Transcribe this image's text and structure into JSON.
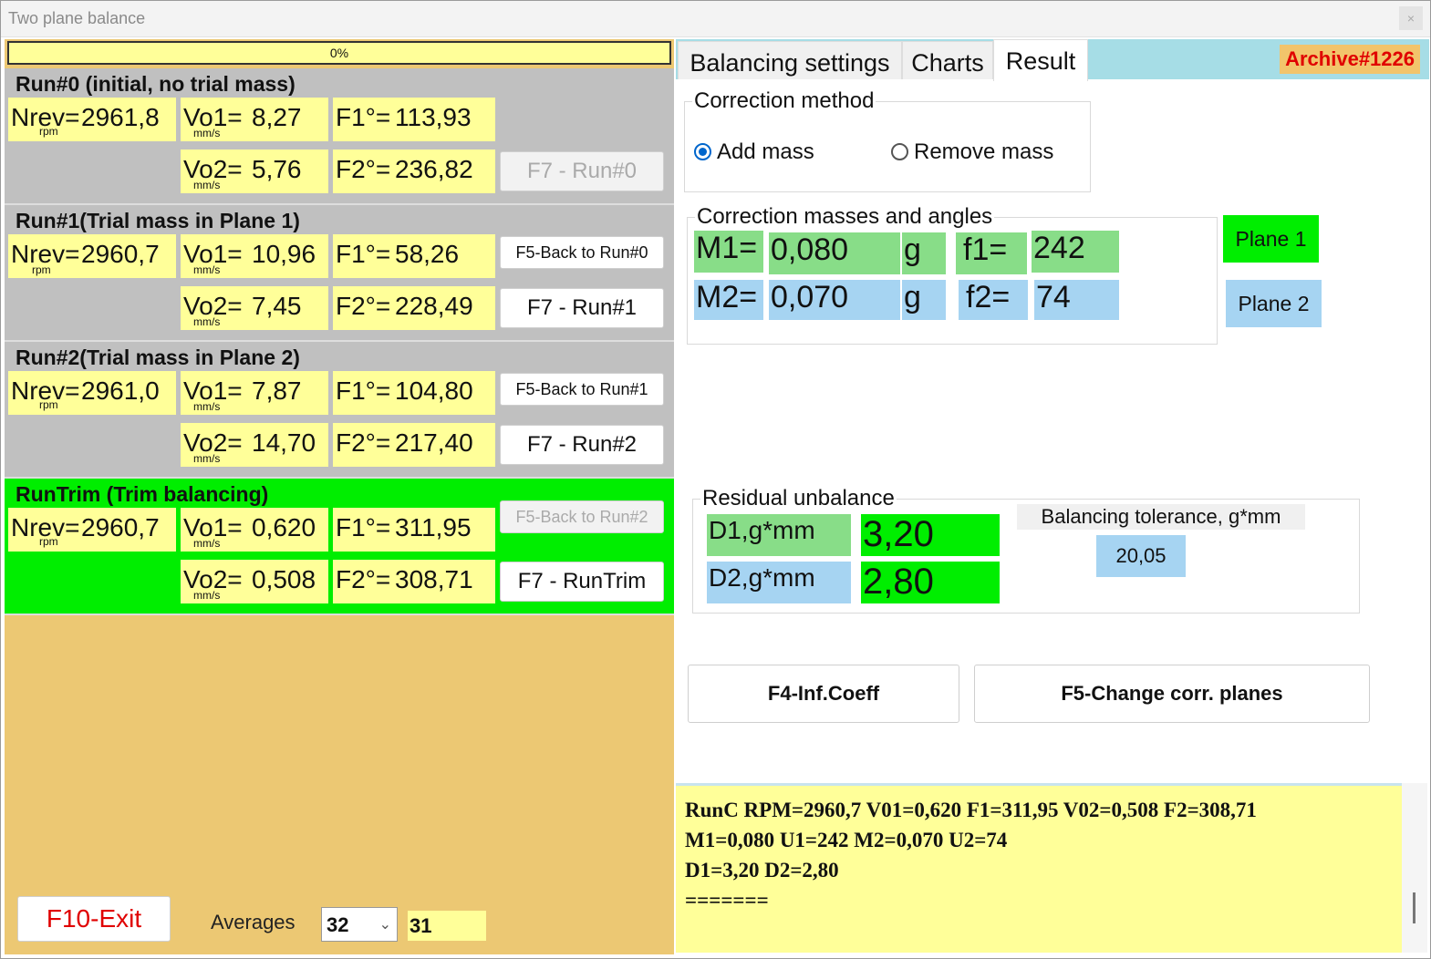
{
  "window": {
    "title": "Two plane balance",
    "close_label": "×"
  },
  "progress": {
    "text": "0%",
    "value": 0
  },
  "labels": {
    "nrev": "Nrev=",
    "rpm": "rpm",
    "vo1": "Vo1=",
    "vo2": "Vo2=",
    "mms": "mm/s",
    "f1": "F1°=",
    "f2": "F2°="
  },
  "runs": [
    {
      "title": "Run#0 (initial, no trial mass)",
      "nrev": "2961,8",
      "vo1": "8,27",
      "f1": "113,93",
      "vo2": "5,76",
      "f2": "236,82",
      "f7_label": "F7 - Run#0"
    },
    {
      "title": "Run#1(Trial mass in Plane 1)",
      "nrev": "2960,7",
      "vo1": "10,96",
      "f1": "58,26",
      "vo2": "7,45",
      "f2": "228,49",
      "f5_label": "F5-Back to Run#0",
      "f7_label": "F7 - Run#1"
    },
    {
      "title": "Run#2(Trial mass in Plane 2)",
      "nrev": "2961,0",
      "vo1": "7,87",
      "f1": "104,80",
      "vo2": "14,70",
      "f2": "217,40",
      "f5_label": "F5-Back to Run#1",
      "f7_label": "F7 - Run#2"
    },
    {
      "title": "RunTrim (Trim balancing)",
      "nrev": "2960,7",
      "vo1": "0,620",
      "f1": "311,95",
      "vo2": "0,508",
      "f2": "308,71",
      "f5_label": "F5-Back to Run#2",
      "f7_label": "F7 - RunTrim"
    }
  ],
  "footer": {
    "exit_label": "F10-Exit",
    "averages_label": "Averages",
    "averages_selected": "32",
    "averages_value": "31"
  },
  "tabs": [
    {
      "label": "Balancing settings"
    },
    {
      "label": "Charts"
    },
    {
      "label": "Result"
    }
  ],
  "archive": "Archive#1226",
  "correction_method": {
    "title": "Correction method",
    "options": [
      "Add mass",
      "Remove mass"
    ],
    "selected": "Add mass"
  },
  "correction_masses": {
    "title": "Correction masses and angles",
    "m1_label": "M1=",
    "m1_value": "0,080",
    "m1_unit": "g",
    "f1_label": "f1=",
    "f1_value": "242",
    "m2_label": "M2=",
    "m2_value": "0,070",
    "m2_unit": "g",
    "f2_label": "f2=",
    "f2_value": "74"
  },
  "planes": {
    "plane1": "Plane 1",
    "plane2": "Plane 2"
  },
  "residual": {
    "title": "Residual unbalance",
    "d1_label": "D1,g*mm",
    "d1_value": "3,20",
    "d2_label": "D2,g*mm",
    "d2_value": "2,80",
    "tolerance_label": "Balancing tolerance, g*mm",
    "tolerance_value": "20,05"
  },
  "actions": {
    "inf_coeff": "F4-Inf.Coeff",
    "change_planes": "F5-Change corr. planes"
  },
  "log": [
    "RunC  RPM=2960,7 V01=0,620 F1=311,95 V02=0,508 F2=308,71",
    "M1=0,080 U1=242 M2=0,070 U2=74",
    "D1=3,20 D2=2,80",
    "======="
  ],
  "colors": {
    "cell_yellow": "#ffff99",
    "panel_gray": "#c0c0c0",
    "trim_green": "#00ee00",
    "left_bg": "#ecc873",
    "tab_bar": "#a6dde6",
    "plane1": "#00ee00",
    "plane2": "#a6d4f2",
    "archive_text": "#e00000",
    "exit_text": "#e00000"
  }
}
